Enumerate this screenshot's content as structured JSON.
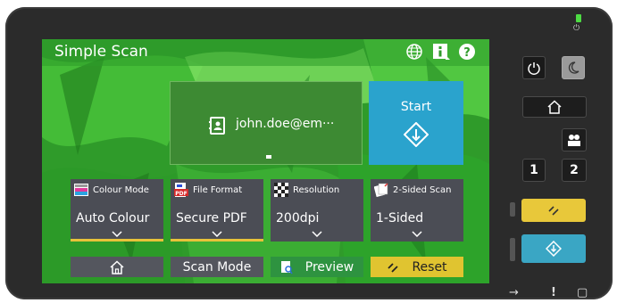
{
  "screen": {
    "title": "Simple Scan",
    "icons": [
      "globe-icon",
      "info-icon",
      "help-icon"
    ]
  },
  "destination": {
    "email": "john.doe@em···",
    "icon": "address-book-icon"
  },
  "start": {
    "label": "Start",
    "icon": "start-diamond-icon"
  },
  "settings": [
    {
      "label": "Colour Mode",
      "value": "Auto Colour",
      "icon": "colour-mode-icon"
    },
    {
      "label": "File Format",
      "value": "Secure PDF",
      "icon": "pdf-file-icon"
    },
    {
      "label": "Resolution",
      "value": "200dpi",
      "icon": "resolution-icon"
    },
    {
      "label": "2-Sided Scan",
      "value": "1-Sided",
      "icon": "two-sided-scan-icon"
    }
  ],
  "bottom_bar": {
    "home_icon": "home-icon",
    "scan_mode": "Scan Mode",
    "preview": "Preview",
    "reset": "Reset"
  },
  "hard_keys": {
    "one": "1",
    "two": "2"
  },
  "colors": {
    "screen_green": "#2f9b2a",
    "start_blue": "#2aa3cd",
    "tile_gray": "#4b4d55",
    "accent_yellow": "#e7c23a",
    "reset_yellow": "#e0c430",
    "start_key_teal": "#3aa6c4"
  }
}
